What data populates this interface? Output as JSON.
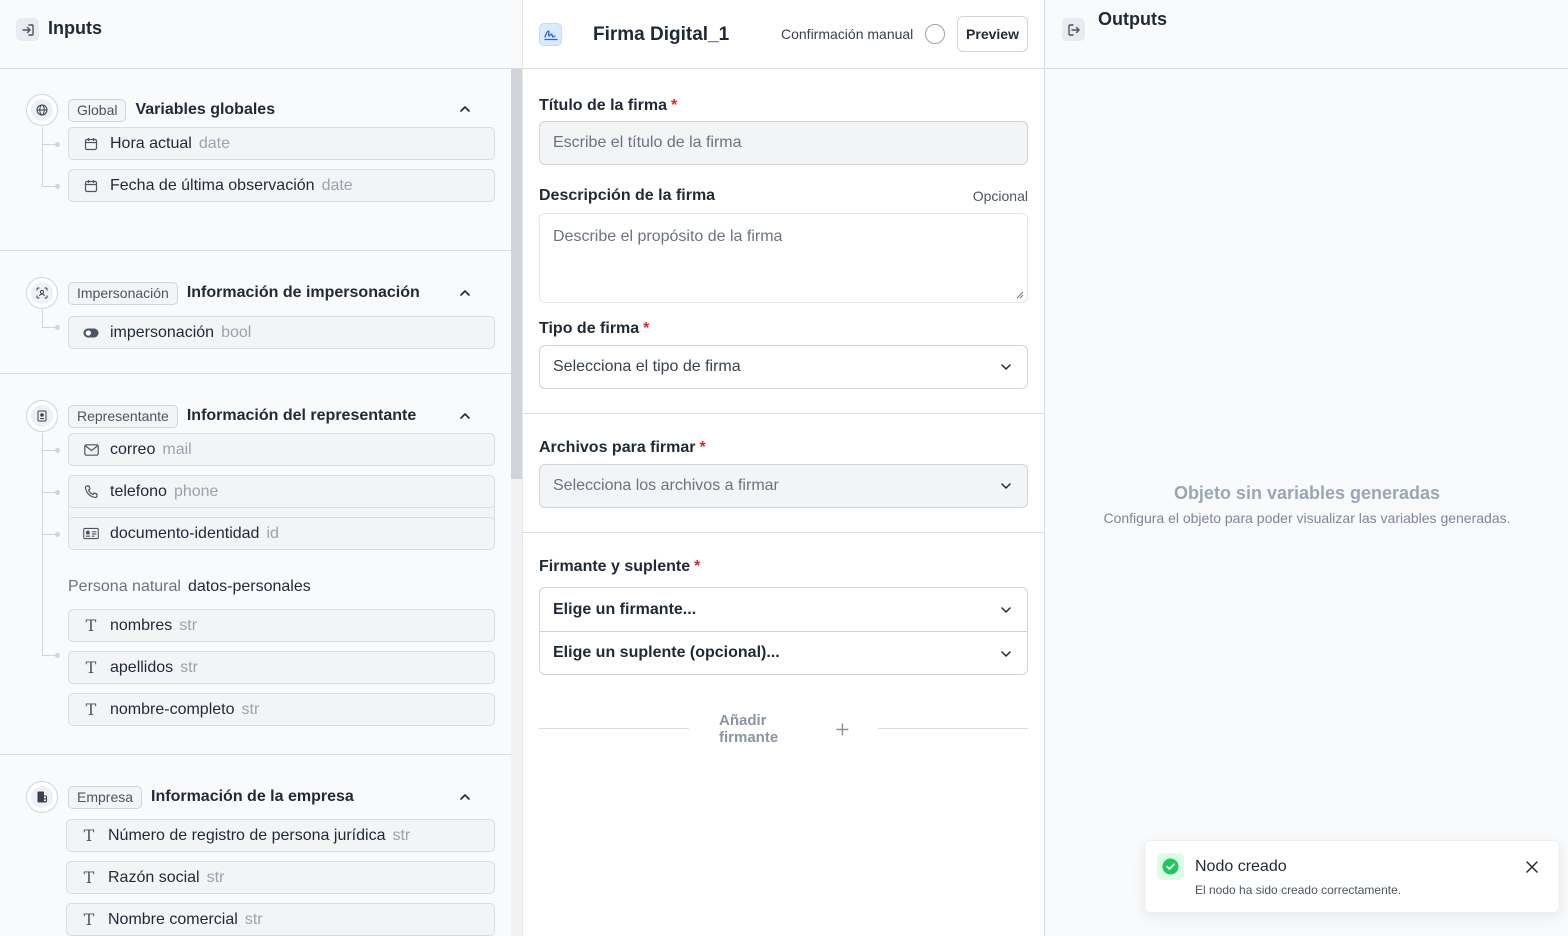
{
  "inputs_panel": {
    "title": "Inputs",
    "sections": [
      {
        "tag": "Global",
        "title": "Variables globales",
        "icon": "globe-icon",
        "fields": [
          {
            "name": "Hora actual",
            "type": "date",
            "icon": "calendar-icon"
          },
          {
            "name": "Fecha de última observación",
            "type": "date",
            "icon": "calendar-icon"
          }
        ]
      },
      {
        "tag": "Impersonación",
        "title": "Información de impersonación",
        "icon": "user-scan-icon",
        "fields": [
          {
            "name": "impersonación",
            "type": "bool",
            "icon": "toggle-icon"
          }
        ]
      },
      {
        "tag": "Representante",
        "title": "Información del representante",
        "icon": "badge-icon",
        "fields": [
          {
            "name": "correo",
            "type": "mail",
            "icon": "mail-icon"
          },
          {
            "name": "telefono",
            "type": "phone",
            "icon": "phone-icon"
          },
          {
            "name": "documento-identidad",
            "type": "id",
            "icon": "id-card-icon"
          }
        ],
        "subgroup": {
          "label": "Persona natural",
          "name": "datos-personales",
          "fields": [
            {
              "name": "nombres",
              "type": "str",
              "icon": "text-icon"
            },
            {
              "name": "apellidos",
              "type": "str",
              "icon": "text-icon"
            },
            {
              "name": "nombre-completo",
              "type": "str",
              "icon": "text-icon"
            }
          ]
        }
      },
      {
        "tag": "Empresa",
        "title": "Información de la empresa",
        "icon": "building-icon",
        "fields": [
          {
            "name": "Número de registro de persona jurídica",
            "type": "str",
            "icon": "text-icon"
          },
          {
            "name": "Razón social",
            "type": "str",
            "icon": "text-icon"
          },
          {
            "name": "Nombre comercial",
            "type": "str",
            "icon": "text-icon"
          }
        ]
      }
    ]
  },
  "node": {
    "title": "Firma Digital_1",
    "icon": "signature-icon",
    "manual_confirmation_label": "Confirmación manual",
    "preview_label": "Preview"
  },
  "form": {
    "title_label": "Título de la firma",
    "title_placeholder": "Escribe el título de la firma",
    "description_label": "Descripción de la firma",
    "optional_label": "Opcional",
    "description_placeholder": "Describe el propósito de la firma",
    "type_label": "Tipo de firma",
    "type_placeholder": "Selecciona el tipo de firma",
    "files_label": "Archivos para firmar",
    "files_placeholder": "Selecciona los archivos a firmar",
    "signer_label": "Firmante y suplente",
    "signer_placeholder": "Elige un firmante...",
    "substitute_placeholder": "Elige un suplente (opcional)...",
    "add_signer_label": "Añadir firmante",
    "required_mark": "*"
  },
  "outputs_panel": {
    "title": "Outputs",
    "empty_title": "Objeto sin variables generadas",
    "empty_subtitle": "Configura el objeto para poder visualizar las variables generadas."
  },
  "toast": {
    "title": "Nodo creado",
    "message": "El nodo ha sido creado correctamente."
  },
  "colors": {
    "required": "#dc2626",
    "success": "#22c55e",
    "accent": "#2563eb"
  }
}
